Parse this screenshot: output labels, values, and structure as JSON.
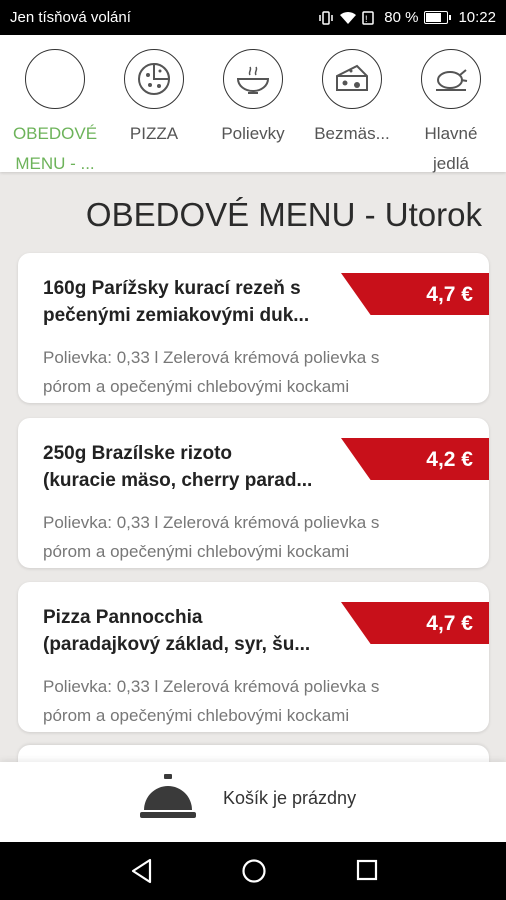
{
  "status": {
    "carrier": "Jen tísňová volání",
    "battery_pct": "80 %",
    "battery_level": 0.8,
    "time": "10:22"
  },
  "categories": [
    {
      "label": "OBEDOVÉ MENU - ...",
      "line1": "OBEDOVÉ",
      "line2": "MENU - ...",
      "icon": "blank-circle-icon",
      "active": true
    },
    {
      "label": "PIZZA",
      "line1": "PIZZA",
      "line2": "",
      "icon": "pizza-icon",
      "active": false
    },
    {
      "label": "Polievky",
      "line1": "Polievky",
      "line2": "",
      "icon": "soup-bowl-icon",
      "active": false
    },
    {
      "label": "Bezmäs...",
      "line1": "Bezmäs...",
      "line2": "",
      "icon": "cheese-icon",
      "active": false
    },
    {
      "label": "Hlavné jedlá",
      "line1": "Hlavné",
      "line2": "jedlá",
      "icon": "roast-chicken-icon",
      "active": false
    }
  ],
  "section_title": "OBEDOVÉ MENU - Utorok",
  "items": [
    {
      "name_line1": "160g Parížsky kurací rezeň s",
      "name_line2": "pečenými zemiakovými duk...",
      "price": "4,7 €",
      "desc_line1": "Polievka: 0,33 l Zelerová krémová polievka s",
      "desc_line2": "pórom a opečenými chlebovými kockami"
    },
    {
      "name_line1": "250g Brazílske rizoto",
      "name_line2": "(kuracie mäso, cherry parad...",
      "price": "4,2 €",
      "desc_line1": "Polievka: 0,33 l Zelerová krémová polievka s",
      "desc_line2": "pórom a opečenými chlebovými kockami"
    },
    {
      "name_line1": "Pizza Pannocchia",
      "name_line2": "(paradajkový základ, syr, šu...",
      "price": "4,7 €",
      "desc_line1": "Polievka: 0,33 l Zelerová krémová polievka s",
      "desc_line2": "pórom a opečenými chlebovými kockami"
    }
  ],
  "cart": {
    "text": "Košík je prázdny",
    "icon": "service-bell-icon"
  },
  "navbar": {
    "back": "back-icon",
    "home": "home-icon",
    "recents": "recents-icon"
  },
  "colors": {
    "accent_green": "#6db35a",
    "price_red": "#c8101a"
  }
}
